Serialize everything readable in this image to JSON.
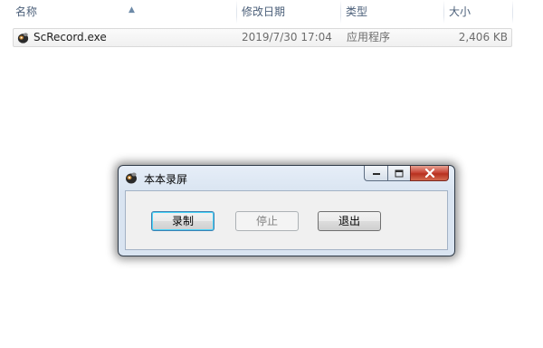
{
  "explorer": {
    "columns": [
      {
        "key": "name",
        "label": "名称"
      },
      {
        "key": "date",
        "label": "修改日期"
      },
      {
        "key": "type",
        "label": "类型"
      },
      {
        "key": "size",
        "label": "大小"
      }
    ],
    "sort": {
      "column": "name",
      "direction": "ascending",
      "icon": "sort-up-arrow"
    },
    "files": [
      {
        "name": "ScRecord.exe",
        "modified": "2019/7/30 17:04",
        "type": "应用程序",
        "size": "2,406 KB",
        "icon": "app-icon"
      }
    ]
  },
  "dialog": {
    "title": "本本录屏",
    "icon": "recorder-app-icon",
    "caption_buttons": [
      "minimize",
      "maximize",
      "close"
    ],
    "buttons": {
      "record": "录制",
      "stop": "停止",
      "exit": "退出"
    },
    "button_states": {
      "record": "default",
      "stop": "disabled",
      "exit": "enabled"
    }
  },
  "colors": {
    "header_text": "#4c607a",
    "close_button": "#c9483a",
    "dialog_frame": "#d9e4f1",
    "default_button_border": "#3c7fb1"
  }
}
